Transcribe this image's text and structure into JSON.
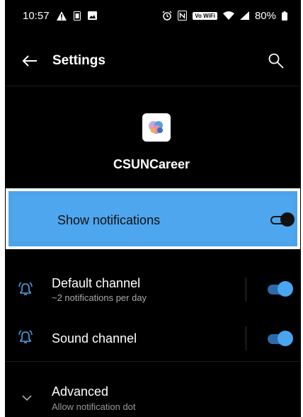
{
  "status_bar": {
    "time": "10:57",
    "left_icons": [
      "alert-icon",
      "sim-icon",
      "image-icon"
    ],
    "right_icons": [
      "alarm-icon",
      "nfc-icon",
      "vowifi-icon",
      "wifi-icon",
      "signal-icon",
      "battery-icon"
    ],
    "vowifi_label": "Vo WiFi",
    "battery": "80%"
  },
  "appbar": {
    "title": "Settings"
  },
  "app": {
    "name": "CSUNCareer"
  },
  "show_notifications": {
    "label": "Show notifications",
    "enabled": true
  },
  "channels": [
    {
      "label": "Default channel",
      "sub": "~2 notifications per day",
      "enabled": true
    },
    {
      "label": "Sound channel",
      "sub": "",
      "enabled": true
    }
  ],
  "advanced": {
    "title": "Advanced",
    "subtitle": "Allow notification dot"
  },
  "colors": {
    "accent": "#4ea6ee",
    "switch_on": "#4aa5f0",
    "background": "#000000"
  }
}
